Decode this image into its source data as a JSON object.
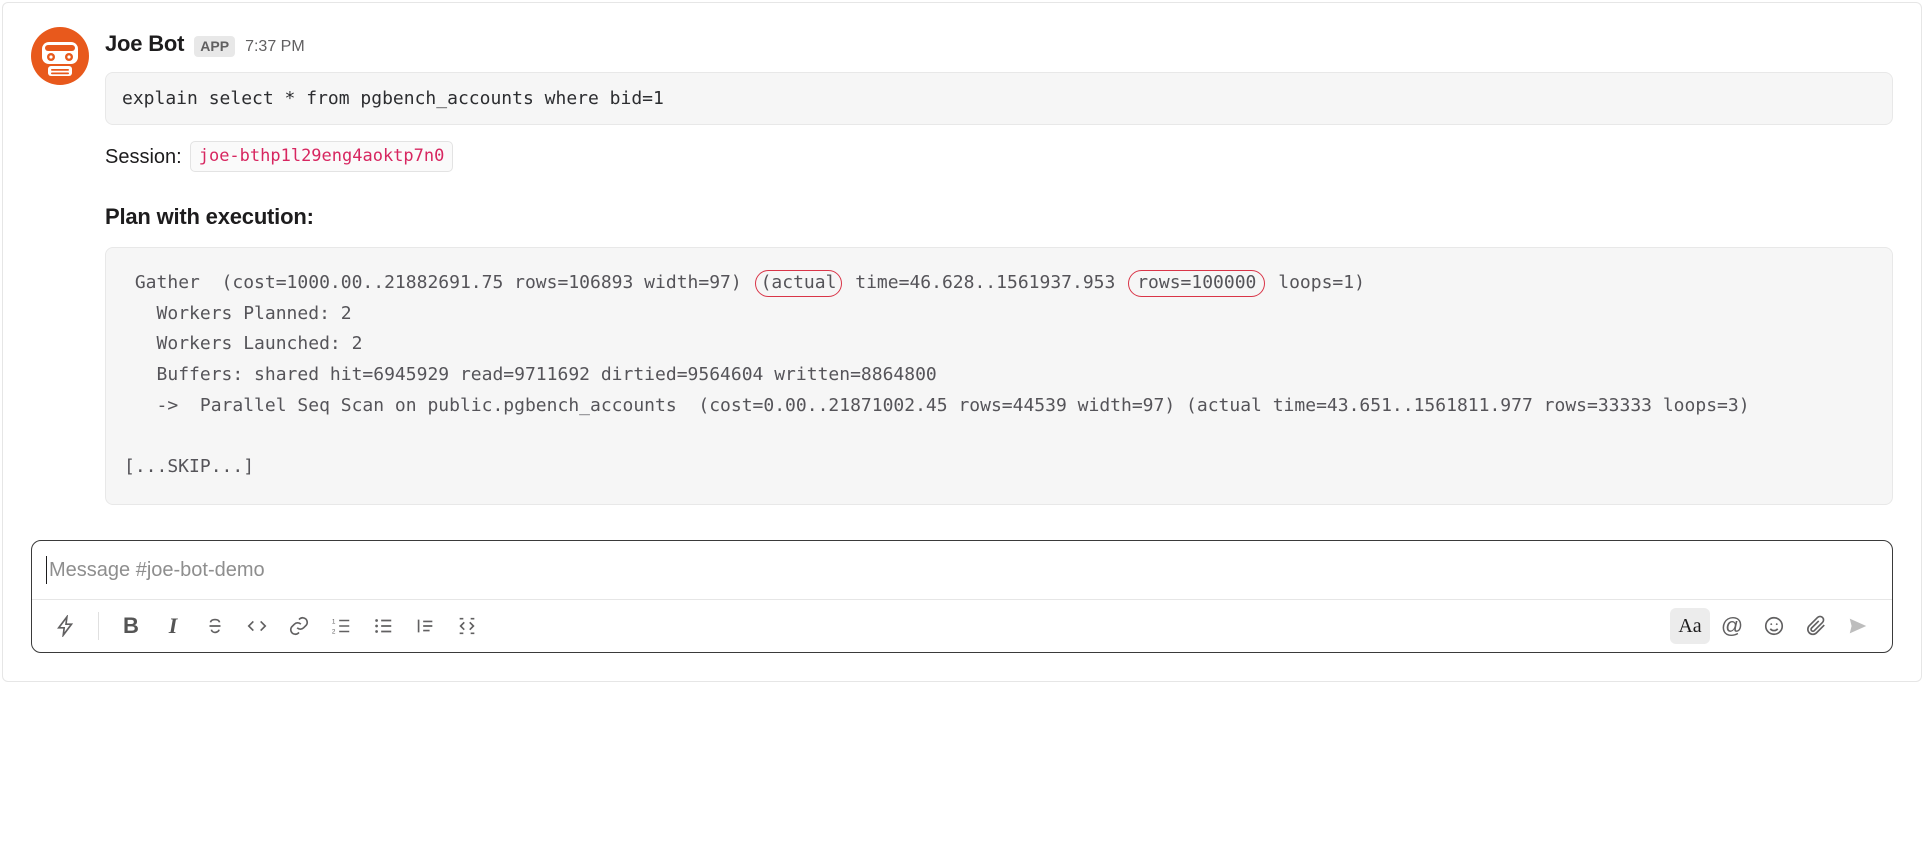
{
  "message": {
    "sender": "Joe Bot",
    "badge": "APP",
    "timestamp": "7:37 PM",
    "query_code": "explain select * from pgbench_accounts where bid=1",
    "session_label": "Session:",
    "session_id": "joe-bthp1l29eng4aoktp7n0",
    "plan_title": "Plan with execution:",
    "plan": {
      "line1_leading": " Gather  (cost=1000.00..21882691.75 rows=106893 width=97) ",
      "circle_actual": "(actual",
      "line1_between": " time=46.628..1561937.953 ",
      "circle_rows": "rows=100000",
      "line1_trailing": " loops=1)",
      "line2": "   Workers Planned: 2",
      "line3": "   Workers Launched: 2",
      "line4": "   Buffers: shared hit=6945929 read=9711692 dirtied=9564604 written=8864800",
      "line5": "   ->  Parallel Seq Scan on public.pgbench_accounts  (cost=0.00..21871002.45 rows=44539 width=97) (actual time=43.651..1561811.977 rows=33333 loops=3)",
      "skip": "[...SKIP...]"
    }
  },
  "composer": {
    "placeholder": "Message #joe-bot-demo"
  },
  "toolbar": {
    "shortcuts_label": "Shortcuts",
    "bold_label": "Bold",
    "italic_label": "Italic",
    "strike_label": "Strikethrough",
    "code_label": "Code",
    "link_label": "Link",
    "ordered_list_label": "Ordered list",
    "bullet_list_label": "Bullet list",
    "quote_label": "Blockquote",
    "codeblock_label": "Code block",
    "formatting_label": "Aa",
    "mention_label": "@",
    "emoji_label": "Emoji",
    "attach_label": "Attach",
    "send_label": "Send"
  }
}
